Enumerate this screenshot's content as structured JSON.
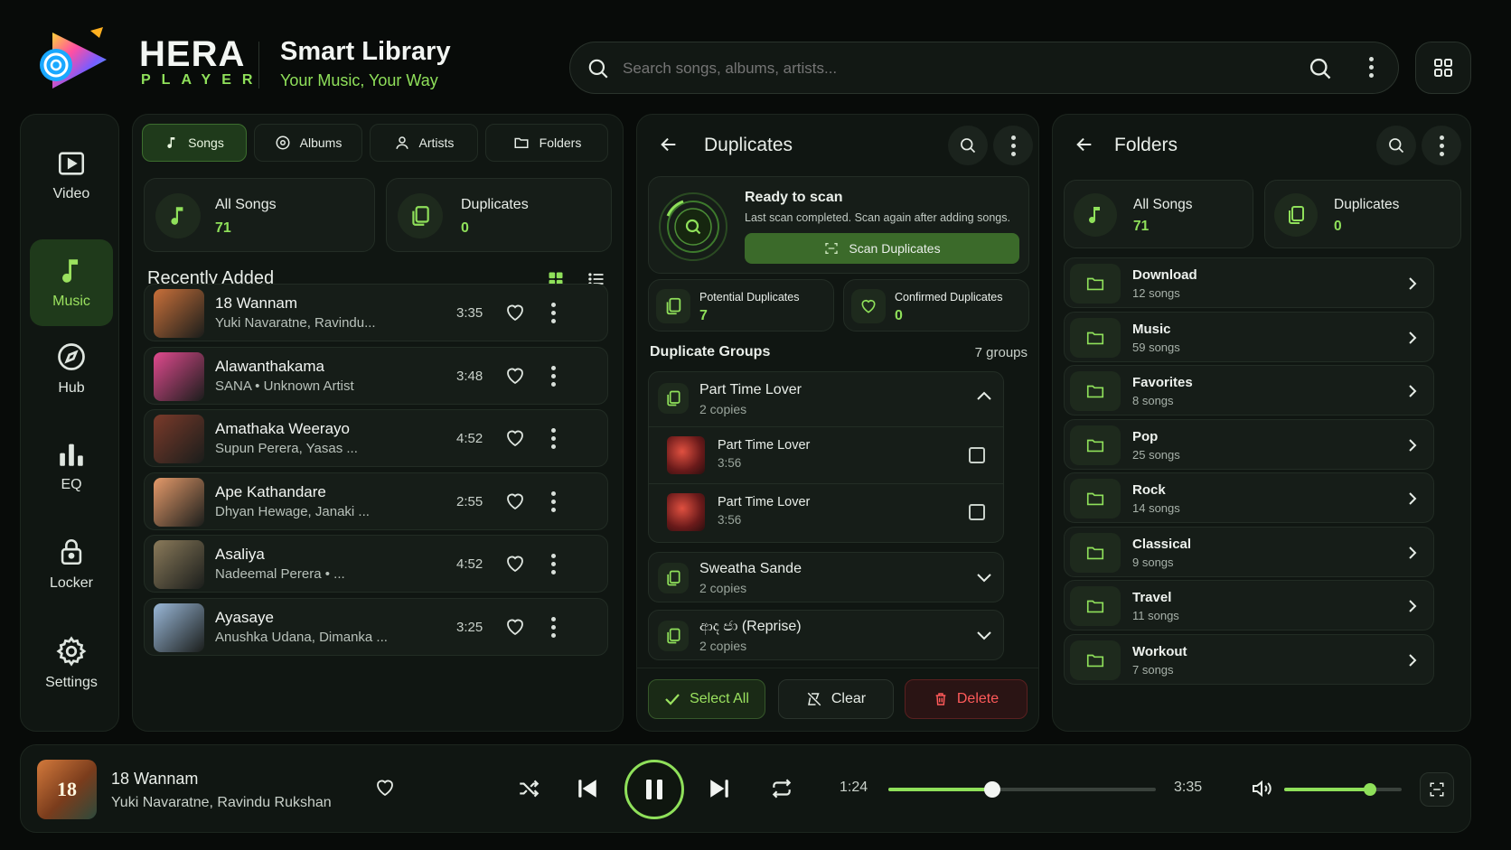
{
  "brand": {
    "name": "HERA",
    "sub": "PLAYER"
  },
  "header": {
    "title": "Smart Library",
    "subtitle": "Your Music, Your Way"
  },
  "search": {
    "placeholder": "Search songs, albums, artists..."
  },
  "sidebar": {
    "items": [
      {
        "label": "Video",
        "icon": "video-icon"
      },
      {
        "label": "Music",
        "icon": "music-note-icon",
        "active": true
      },
      {
        "label": "Hub",
        "icon": "compass-icon"
      },
      {
        "label": "EQ",
        "icon": "equalizer-icon"
      },
      {
        "label": "Locker",
        "icon": "lock-icon"
      },
      {
        "label": "Settings",
        "icon": "gear-icon"
      }
    ]
  },
  "library": {
    "tabs": [
      {
        "label": "Songs",
        "icon": "music-note-icon",
        "active": true
      },
      {
        "label": "Albums",
        "icon": "disc-icon"
      },
      {
        "label": "Artists",
        "icon": "person-icon"
      },
      {
        "label": "Folders",
        "icon": "folder-icon"
      }
    ],
    "stats": [
      {
        "label": "All Songs",
        "value": "71",
        "icon": "music-note-icon"
      },
      {
        "label": "Duplicates",
        "value": "0",
        "icon": "copy-icon"
      }
    ],
    "recent_title": "Recently Added",
    "songs": [
      {
        "title": "18 Wannam",
        "artist": "Yuki Navaratne, Ravindu...",
        "duration": "3:35",
        "color": "#c9703a"
      },
      {
        "title": "Alawanthakama",
        "artist": "SANA • Unknown Artist",
        "duration": "3:48",
        "color": "#e04a8e"
      },
      {
        "title": "Amathaka Weerayo",
        "artist": "Supun Perera, Yasas ...",
        "duration": "4:52",
        "color": "#7a3a2a"
      },
      {
        "title": "Ape Kathandare",
        "artist": "Dhyan Hewage, Janaki ...",
        "duration": "2:55",
        "color": "#e59a6a"
      },
      {
        "title": "Asaliya",
        "artist": "Nadeemal Perera • ...",
        "duration": "4:52",
        "color": "#8a7a5a"
      },
      {
        "title": "Ayasaye",
        "artist": "Anushka Udana, Dimanka ...",
        "duration": "3:25",
        "color": "#9ab8d8"
      }
    ]
  },
  "duplicates": {
    "title": "Duplicates",
    "scan": {
      "title": "Ready to scan",
      "desc": "Last scan completed. Scan again after adding songs.",
      "button": "Scan Duplicates"
    },
    "potential": {
      "label": "Potential Duplicates",
      "value": "7"
    },
    "confirmed": {
      "label": "Confirmed Duplicates",
      "value": "0"
    },
    "groups_title": "Duplicate Groups",
    "groups_count": "7 groups",
    "groups": [
      {
        "title": "Part Time Lover",
        "copies": "2 copies",
        "expanded": true,
        "items": [
          {
            "title": "Part Time Lover",
            "duration": "3:56"
          },
          {
            "title": "Part Time Lover",
            "duration": "3:56"
          }
        ]
      },
      {
        "title": "Sweatha Sande",
        "copies": "2 copies"
      },
      {
        "title": "ආද ජා (Reprise)",
        "copies": "2 copies"
      }
    ],
    "actions": {
      "select_all": "Select All",
      "clear": "Clear",
      "delete": "Delete"
    }
  },
  "folders": {
    "title": "Folders",
    "stats": [
      {
        "label": "All Songs",
        "value": "71"
      },
      {
        "label": "Duplicates",
        "value": "0"
      }
    ],
    "items": [
      {
        "name": "Download",
        "count": "12 songs"
      },
      {
        "name": "Music",
        "count": "59 songs"
      },
      {
        "name": "Favorites",
        "count": "8 songs"
      },
      {
        "name": "Pop",
        "count": "25 songs"
      },
      {
        "name": "Rock",
        "count": "14 songs"
      },
      {
        "name": "Classical",
        "count": "9 songs"
      },
      {
        "name": "Travel",
        "count": "11 songs"
      },
      {
        "name": "Workout",
        "count": "7 songs"
      }
    ]
  },
  "player": {
    "title": "18 Wannam",
    "artist": "Yuki Navaratne, Ravindu Rukshan",
    "elapsed": "1:24",
    "total": "3:35",
    "progress": 0.39,
    "volume": 0.73
  },
  "colors": {
    "accent": "#8fe05a",
    "danger": "#ff4b4b",
    "bg": "#080b09"
  }
}
